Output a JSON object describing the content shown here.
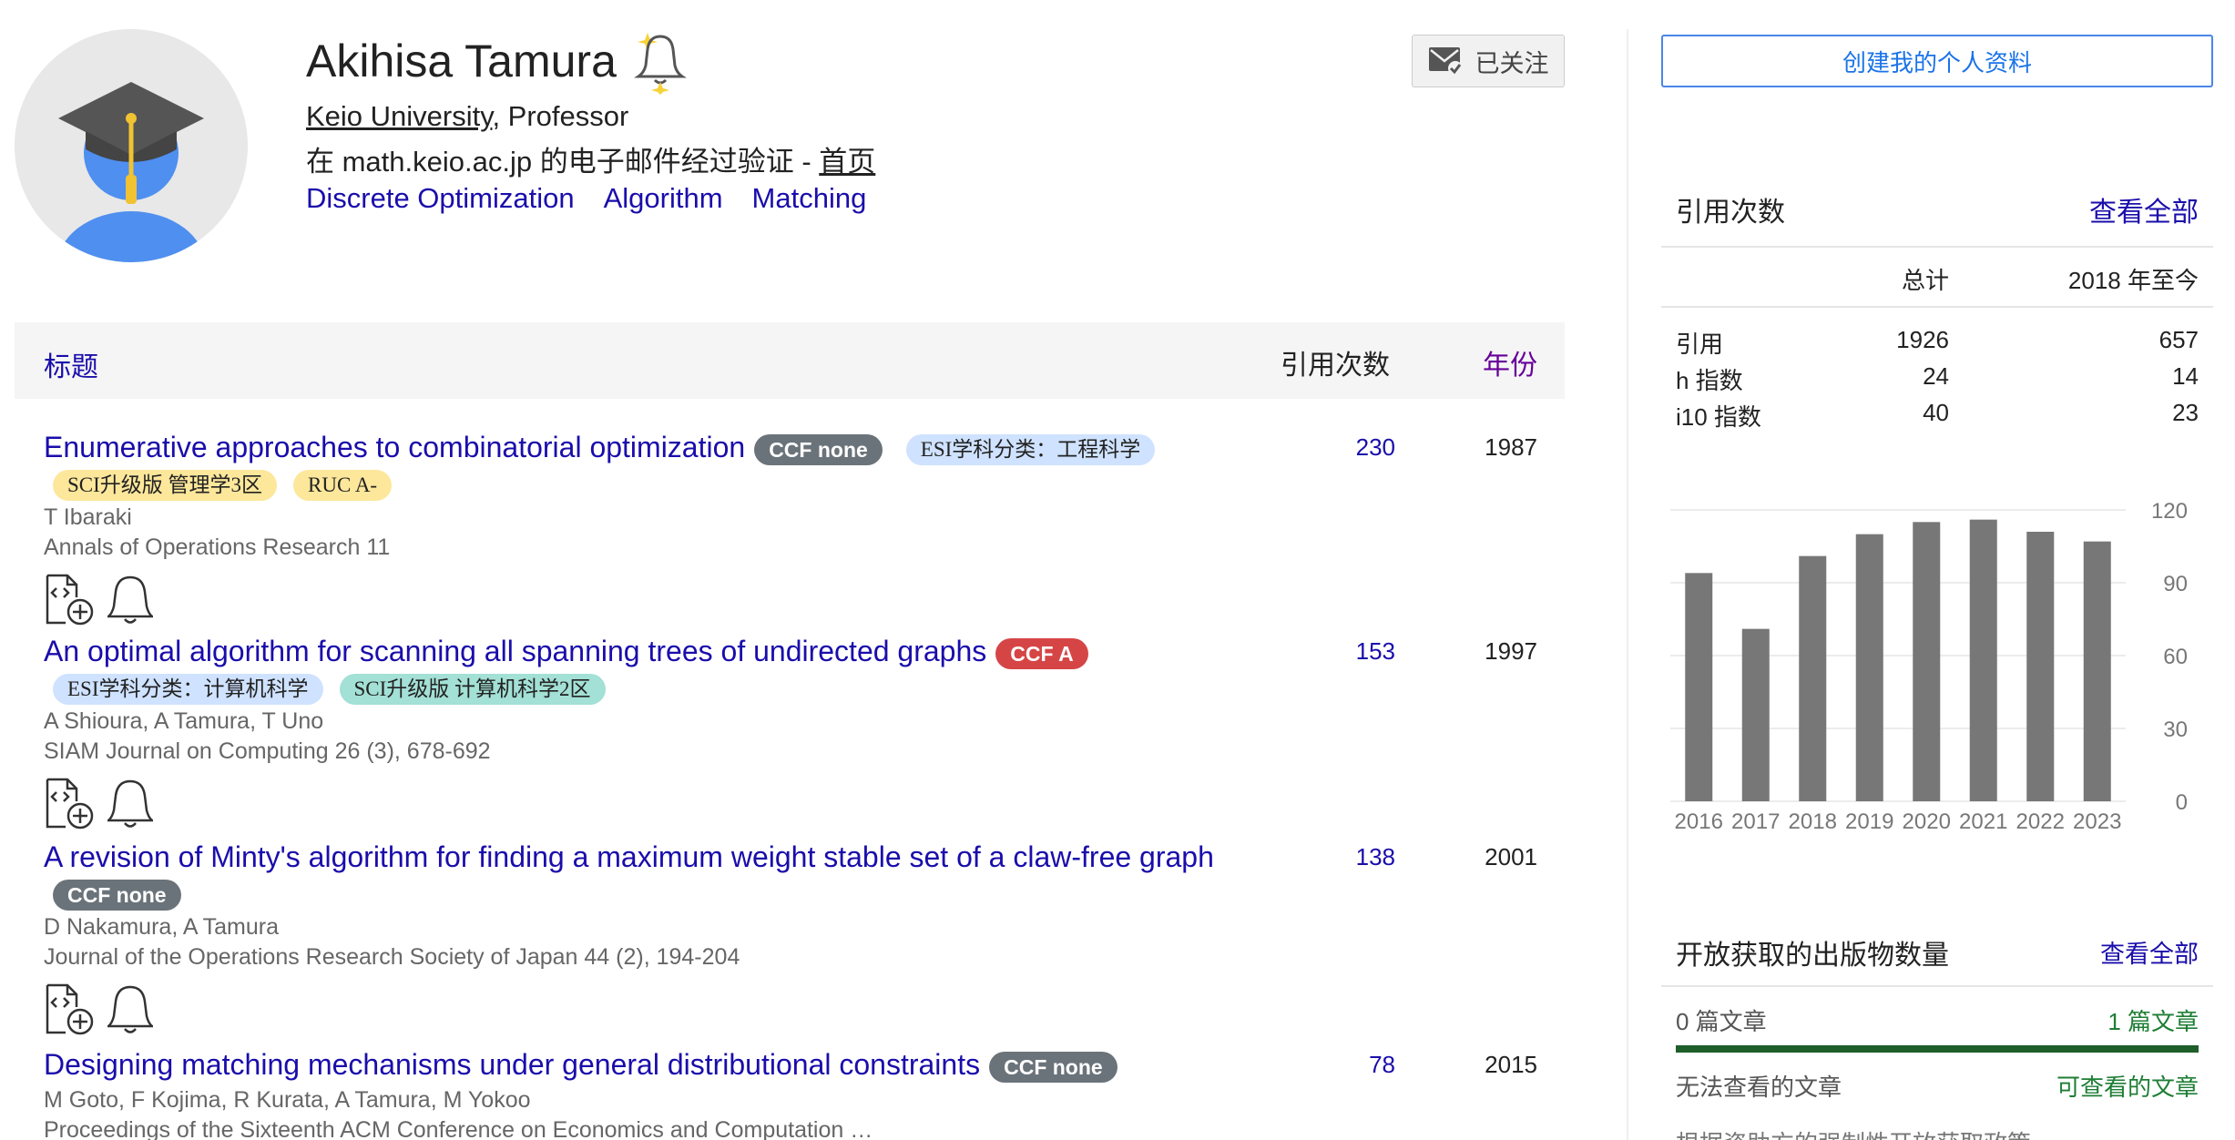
{
  "profile": {
    "name": "Akihisa Tamura",
    "affiliation_link": "Keio University",
    "affiliation_rest": ", Professor",
    "verified_text": "在 math.keio.ac.jp 的电子邮件经过验证 - ",
    "homepage_link": "首页",
    "interests": [
      "Discrete Optimization",
      "Algorithm",
      "Matching"
    ],
    "follow_label": "已关注"
  },
  "table": {
    "col_title": "标题",
    "col_cites": "引用次数",
    "col_year": "年份"
  },
  "publications": [
    {
      "title": "Enumerative approaches to combinatorial optimization",
      "tags_inline": [
        "CCF none",
        "ESI学科分类：工程科学"
      ],
      "tags_next": [
        "SCI升级版 管理学3区",
        "RUC A-"
      ],
      "authors": "T Ibaraki",
      "venue": "Annals of Operations Research 11",
      "cites": "230",
      "year": "1987"
    },
    {
      "title": "An optimal algorithm for scanning all spanning trees of undirected graphs",
      "tags_inline": [
        "CCF A"
      ],
      "tags_next": [
        "ESI学科分类：计算机科学",
        "SCI升级版 计算机科学2区"
      ],
      "authors": "A Shioura, A Tamura, T Uno",
      "venue": "SIAM Journal on Computing 26 (3), 678-692",
      "cites": "153",
      "year": "1997"
    },
    {
      "title": "A revision of Minty's algorithm for finding a maximum weight stable set of a claw-free graph",
      "tags_inline": [],
      "tags_next": [
        "CCF none"
      ],
      "authors": "D Nakamura, A Tamura",
      "venue": "Journal of the Operations Research Society of Japan 44 (2), 194-204",
      "cites": "138",
      "year": "2001"
    },
    {
      "title": "Designing matching mechanisms under general distributional constraints",
      "tags_inline": [
        "CCF none"
      ],
      "tags_next": [],
      "authors": "M Goto, F Kojima, R Kurata, A Tamura, M Yokoo",
      "venue": "Proceedings of the Sixteenth ACM Conference on Economics and Computation …",
      "cites": "78",
      "year": "2015"
    }
  ],
  "sidebar": {
    "create_profile": "创建我的个人资料",
    "cited_by_title": "引用次数",
    "view_all": "查看全部",
    "col_total": "总计",
    "col_since": "2018 年至今",
    "stats": [
      {
        "label": "引用",
        "total": "1926",
        "since": "657"
      },
      {
        "label": "h 指数",
        "total": "24",
        "since": "14"
      },
      {
        "label": "i10 指数",
        "total": "40",
        "since": "23"
      }
    ],
    "oa_title": "开放获取的出版物数量",
    "oa_view_all": "查看全部",
    "oa_unavailable_count": "0 篇文章",
    "oa_available_count": "1 篇文章",
    "oa_unavailable_label": "无法查看的文章",
    "oa_available_label": "可查看的文章",
    "oa_mandates": "根据资助方的强制性开放获取政策"
  },
  "chart_data": {
    "type": "bar",
    "categories": [
      "2016",
      "2017",
      "2018",
      "2019",
      "2020",
      "2021",
      "2022",
      "2023"
    ],
    "values": [
      94,
      71,
      101,
      110,
      115,
      116,
      111,
      107
    ],
    "ylim": [
      0,
      120
    ],
    "yticks": [
      "0",
      "30",
      "60",
      "90",
      "120"
    ],
    "bar_color": "#777777",
    "grid": true
  },
  "colors": {
    "link": "#1a0dab",
    "ccf_none": "#6b737a",
    "ccf_a": "#d64545",
    "esi": "#cfe2ff",
    "sci_yellow": "#fde79b",
    "sci_green": "#a3e0d6",
    "oa_green": "#1e7e34"
  }
}
